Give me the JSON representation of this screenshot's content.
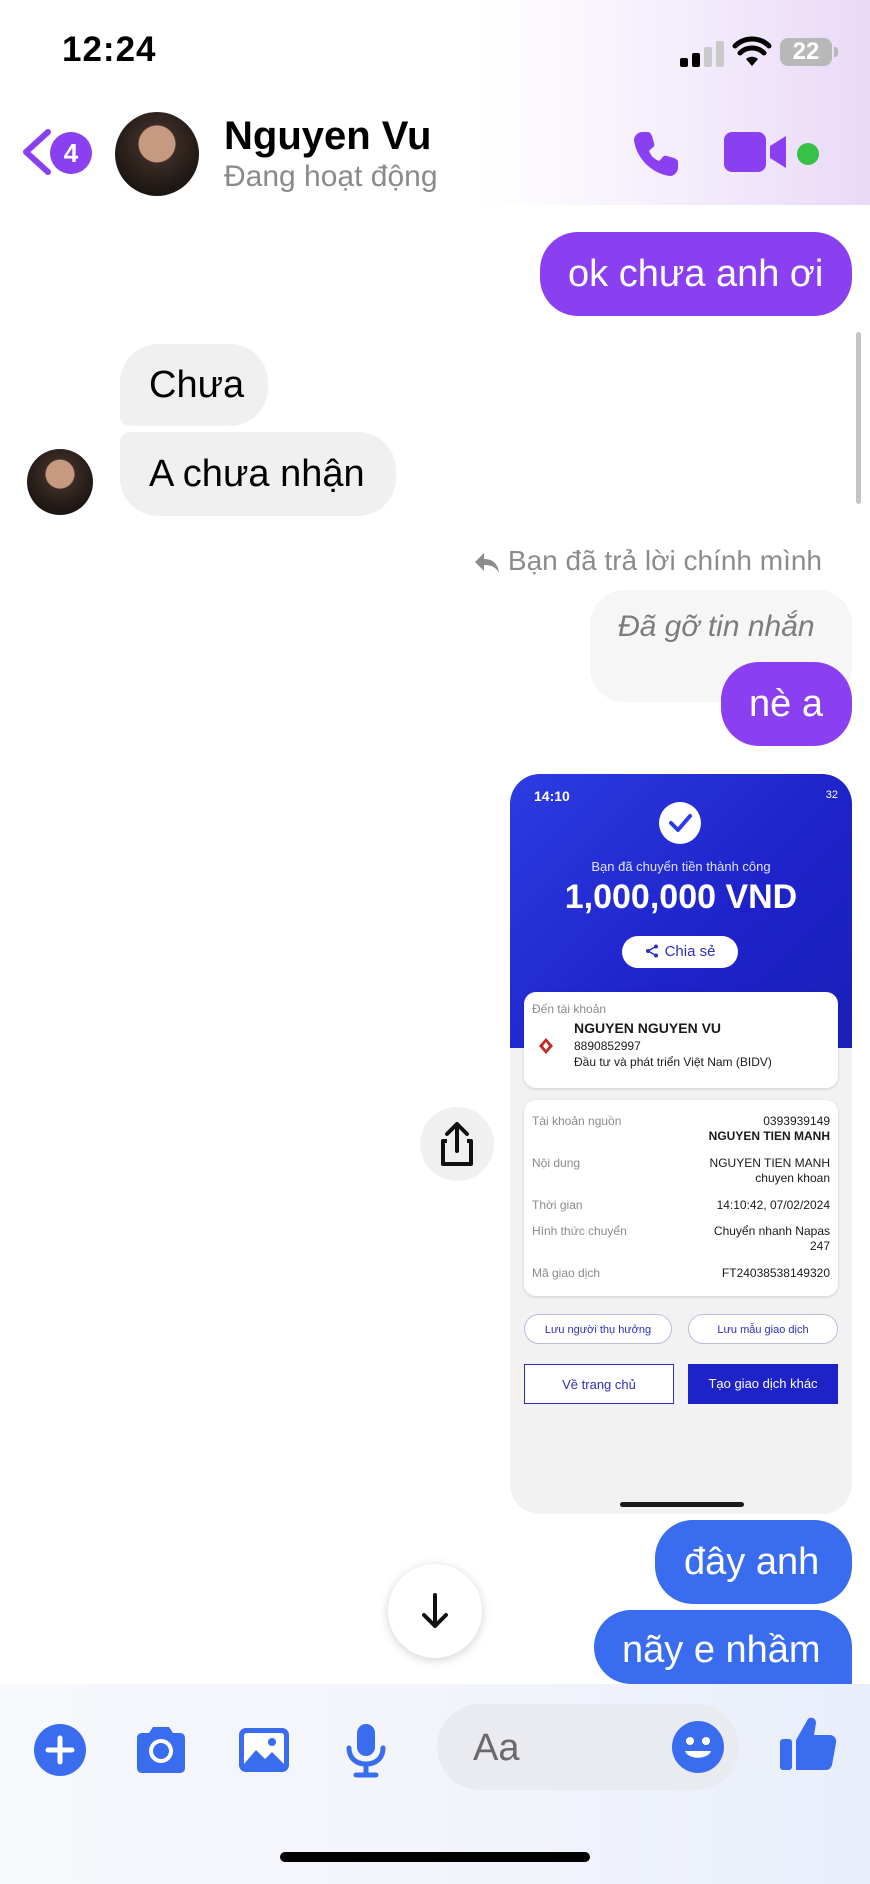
{
  "status_bar": {
    "time": "12:24",
    "battery": "22"
  },
  "header": {
    "unread_count": "4",
    "contact_name": "Nguyen Vu",
    "contact_status": "Đang hoạt động"
  },
  "messages": {
    "m1": "ok chưa anh ơi",
    "m2": "Chưa",
    "m3": "A chưa nhận",
    "reply_note": "Bạn đã trả lời chính mình",
    "removed": "Đã gỡ tin nhắn",
    "m4": "nè a",
    "m5": "đây anh",
    "m6": "nãy e nhầm"
  },
  "receipt": {
    "time": "14:10",
    "battery": "32",
    "success_text": "Bạn đã chuyển tiền thành công",
    "amount": "1,000,000 VND",
    "share": "Chia sẻ",
    "to_label": "Đến tài khoản",
    "recipient_name": "NGUYEN NGUYEN VU",
    "recipient_account": "8890852997",
    "recipient_bank": "Đầu tư và phát triển Việt Nam (BIDV)",
    "rows": [
      {
        "label": "Tài khoản nguồn",
        "value_1": "0393939149",
        "value_2": "NGUYEN TIEN MANH"
      },
      {
        "label": "Nội dung",
        "value_1": "NGUYEN TIEN MANH",
        "value_2": "chuyen khoan"
      },
      {
        "label": "Thời gian",
        "value_1": "14:10:42, 07/02/2024",
        "value_2": ""
      },
      {
        "label": "Hình thức chuyển",
        "value_1": "Chuyển nhanh Napas",
        "value_2": "247"
      },
      {
        "label": "Mã giao dịch",
        "value_1": "FT24038538149320",
        "value_2": ""
      }
    ],
    "save_beneficiary": "Lưu người thụ hưởng",
    "save_template": "Lưu mẫu giao dịch",
    "go_home": "Về trang chủ",
    "new_transaction": "Tạo giao dịch khác"
  },
  "composer": {
    "placeholder": "Aa"
  },
  "colors": {
    "accent_purple": "#8a3ff0",
    "accent_blue": "#3a6cf0",
    "online_green": "#36c246"
  }
}
